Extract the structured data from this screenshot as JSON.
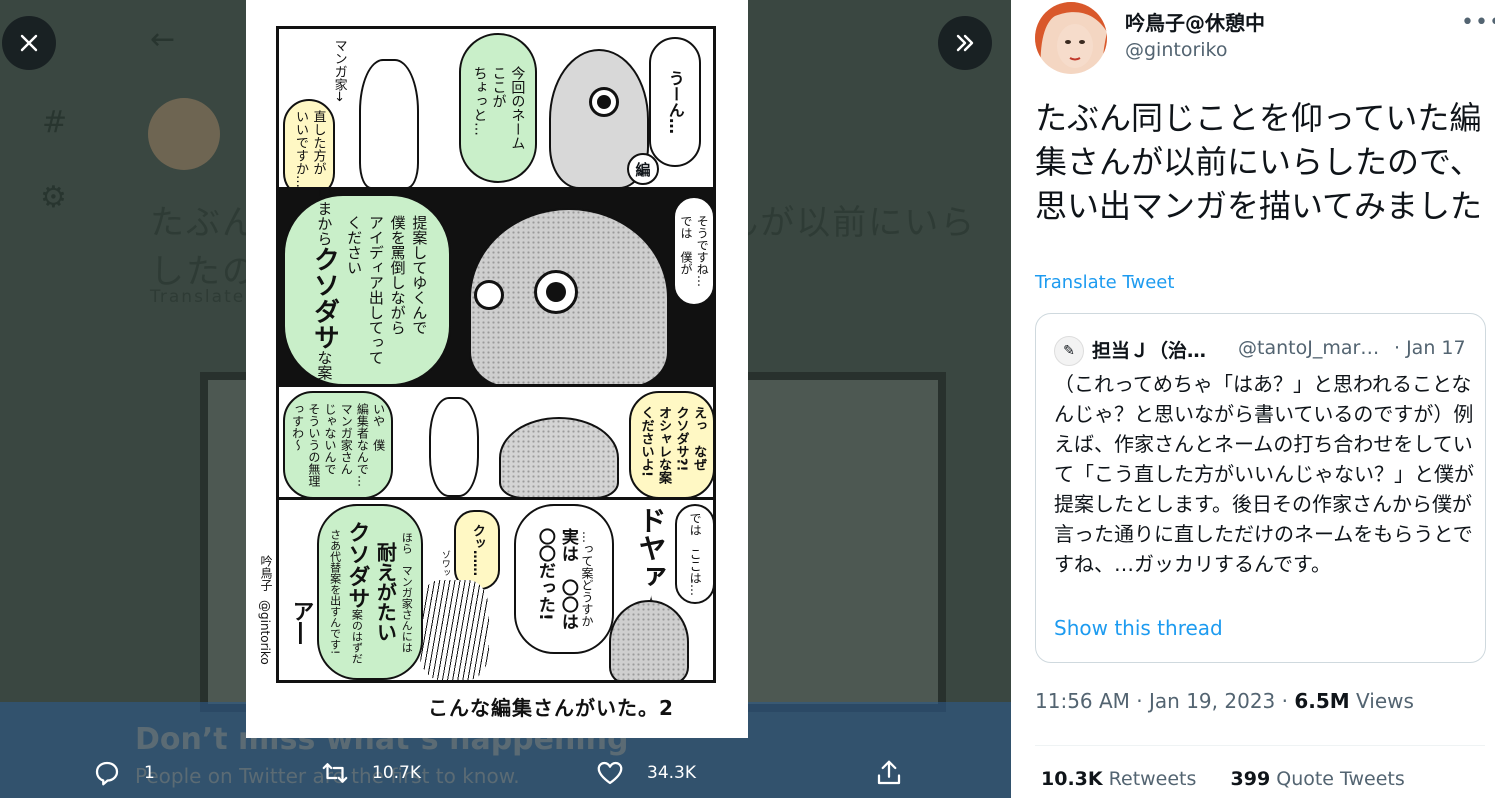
{
  "viewer": {
    "background_text": "たぶん同じことを仰っていた編集さんが以前にいらしたので",
    "background_translate": "Translate Tweet",
    "banner_title": "Don’t miss what’s happening",
    "banner_subtitle": "People on Twitter are the first to know."
  },
  "manga": {
    "caption": "こんな編集さんがいた。2",
    "credit_name": "吟鳥子",
    "credit_handle": "@gintoriko",
    "panel1": {
      "umm": "うーん…",
      "editor_line": "今回のネーム\nここが\nちょっと…",
      "mangaka_label": "マンガ家→",
      "artist_line": "直した方が\nいいですか…",
      "badge": "編"
    },
    "panel2": {
      "small_line": "そうですね…\nでは　僕が",
      "big_line_pre": "いまから",
      "big_word": "クソダサ",
      "big_line_post": "な案を",
      "rest": "提案してゆくんで\n僕を罵倒しながら\nアイディア出してって\nください"
    },
    "panel3": {
      "shout": "えっ　なぜ\nクソダサ?!\nオシャレな案\nくださいよ!",
      "reply": "いや　僕\n編集者なんで…\nマンガ家さん\nじゃないんで\nそういうの無理\nっすわ～"
    },
    "panel4": {
      "top_line": "では　ここは…",
      "sfx": "ドヤァ✧",
      "answer": "実は　〇〇は\n〇〇だった!",
      "question": "…って案どうすか",
      "kuh": "クッ……",
      "sfx2": "ゾワッ",
      "hora": "ほら　マンガ家さんには",
      "tae": "耐えがたい",
      "kusodasa": "クソダサ",
      "ann": "案のはずだ",
      "saa": "さあ代替案を出すんです!",
      "aa": "ア―"
    }
  },
  "actions": {
    "replies": "1",
    "retweets": "10.7K",
    "likes": "34.3K"
  },
  "tweet": {
    "display_name": "吟鳥子@休憩中",
    "handle": "@gintoriko",
    "text": "たぶん同じことを仰っていた編集さんが以前にいらしたので、思い出マンガを描いてみました",
    "translate": "Translate Tweet",
    "quote": {
      "name": "担当Ｊ（治…",
      "handle": "@tantoJ_mar…",
      "date": "· Jan 17",
      "text": "（これってめちゃ「はあ？」と思われることなんじゃ？と思いながら書いているのですが）例えば、作家さんとネームの打ち合わせをしていて「こう直した方がいいんじゃない？」と僕が提案したとします。後日その作家さんから僕が言った通りに直しただけのネームをもらうとですね、…ガッカリするんです。",
      "show_thread": "Show this thread"
    },
    "time": "11:56 AM",
    "date": "Jan 19, 2023",
    "views_count": "6.5M",
    "views_label": "Views",
    "retweets_count": "10.3K",
    "retweets_label": "Retweets",
    "quotes_count": "399",
    "quotes_label": "Quote Tweets"
  },
  "colors": {
    "viewer_bg": "#3a4741",
    "speech_green": "#c9efc9",
    "speech_yellow": "#fff8c4",
    "link_blue": "#1d9bf0",
    "muted_gray": "#536471"
  }
}
